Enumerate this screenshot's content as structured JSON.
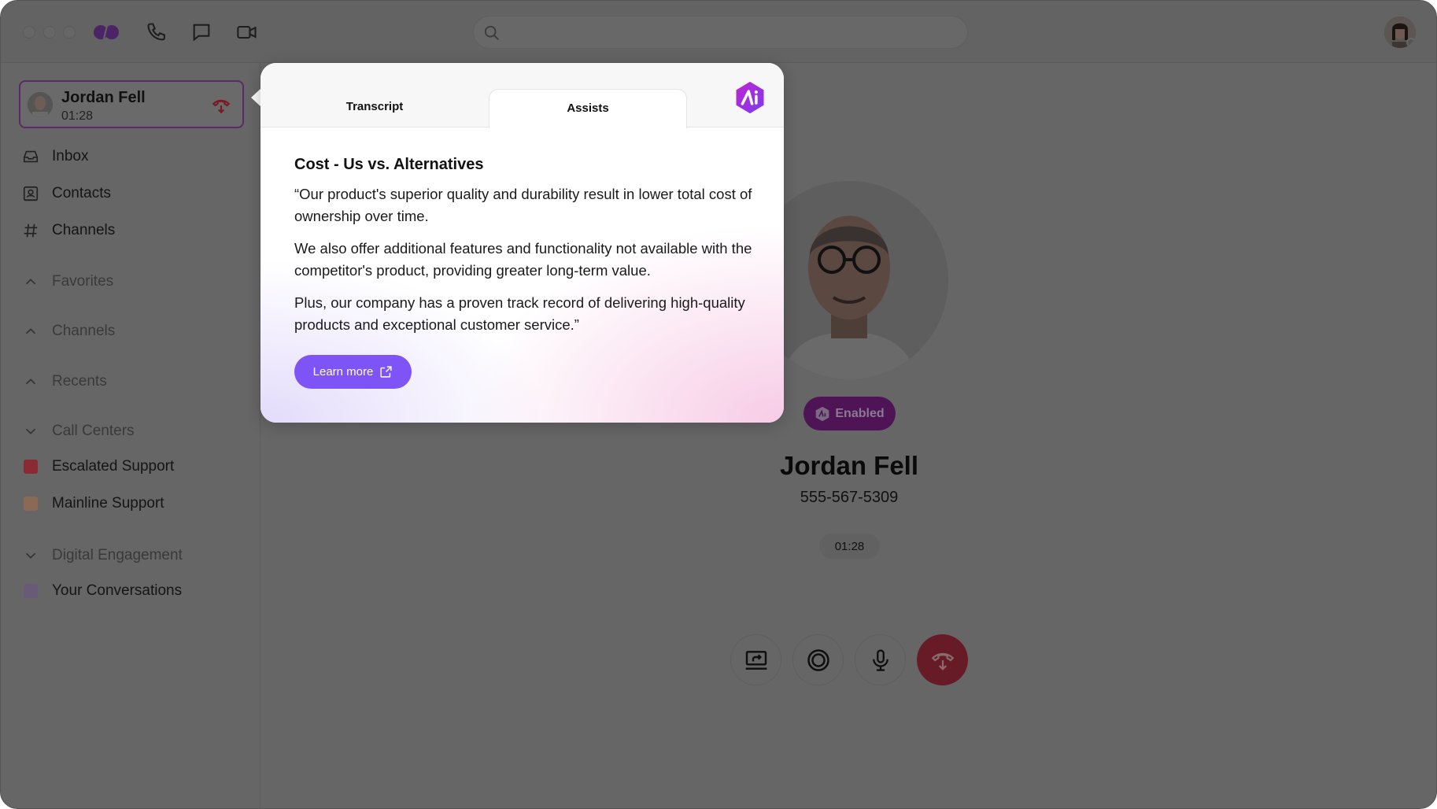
{
  "titlebar": {
    "icons": [
      "app-logo",
      "phone-icon",
      "chat-icon",
      "video-icon"
    ],
    "search_placeholder": ""
  },
  "active_call": {
    "name": "Jordan Fell",
    "duration": "01:28"
  },
  "sidebar": {
    "items": [
      {
        "label": "Inbox",
        "icon": "inbox-icon"
      },
      {
        "label": "Contacts",
        "icon": "contacts-icon"
      },
      {
        "label": "Channels",
        "icon": "hash-icon"
      }
    ],
    "sections": [
      {
        "label": "Favorites",
        "expanded": false
      },
      {
        "label": "Channels",
        "expanded": false
      },
      {
        "label": "Recents",
        "expanded": false
      },
      {
        "label": "Call Centers",
        "expanded": true
      },
      {
        "label": "Digital Engagement",
        "expanded": true
      }
    ],
    "call_centers": [
      {
        "label": "Escalated Support",
        "color": "#8a2a33"
      },
      {
        "label": "Mainline Support",
        "color": "#8a6a55"
      }
    ],
    "digital": [
      {
        "label": "Your Conversations",
        "color": "#6a5a7a"
      }
    ]
  },
  "popup": {
    "tabs": [
      {
        "label": "Transcript",
        "active": false
      },
      {
        "label": "Assists",
        "active": true
      }
    ],
    "title": "Cost - Us vs. Alternatives",
    "paragraphs": [
      "“Our product's superior quality and durability result in lower total cost of ownership over time.",
      "We also offer additional features and functionality not available with the competitor's product, providing greater long-term value.",
      "Plus, our company has a proven track record of delivering high-quality products and exceptional customer service.”"
    ],
    "learn_more": "Learn more",
    "accent": "#7f54f7"
  },
  "call": {
    "ai_badge": "Enabled",
    "name": "Jordan Fell",
    "phone": "555-567-5309",
    "timer": "01:28",
    "controls": [
      "share-screen-icon",
      "record-icon",
      "microphone-icon",
      "hang-up-icon"
    ],
    "hangup_color": "#e0364a"
  }
}
